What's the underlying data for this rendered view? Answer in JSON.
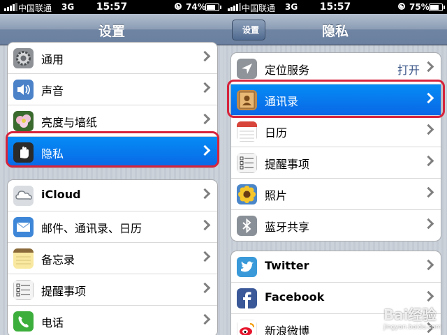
{
  "left": {
    "status": {
      "carrier": "中国联通",
      "network": "3G",
      "time": "15:57",
      "battery": "74%",
      "battery_level": 0.74
    },
    "nav_title": "设置",
    "group1": [
      {
        "label": "通用",
        "icon": "gear-icon"
      },
      {
        "label": "声音",
        "icon": "speaker-icon"
      },
      {
        "label": "亮度与墙纸",
        "icon": "flower-icon"
      },
      {
        "label": "隐私",
        "icon": "hand-icon",
        "selected": true
      }
    ],
    "group2": [
      {
        "label": "iCloud",
        "icon": "cloud-icon"
      },
      {
        "label": "邮件、通讯录、日历",
        "icon": "mail-icon"
      },
      {
        "label": "备忘录",
        "icon": "notes-icon"
      },
      {
        "label": "提醒事项",
        "icon": "reminders-icon"
      },
      {
        "label": "电话",
        "icon": "phone-icon"
      }
    ]
  },
  "right": {
    "status": {
      "carrier": "中国联通",
      "network": "3G",
      "time": "15:57",
      "battery": "75%",
      "battery_level": 0.75
    },
    "back_label": "设置",
    "nav_title": "隐私",
    "group1": [
      {
        "label": "定位服务",
        "icon": "location-arrow-icon",
        "value": "打开"
      },
      {
        "label": "通讯录",
        "icon": "contacts-icon",
        "selected": true
      },
      {
        "label": "日历",
        "icon": "calendar-icon"
      },
      {
        "label": "提醒事项",
        "icon": "reminders-icon"
      },
      {
        "label": "照片",
        "icon": "sunflower-icon"
      },
      {
        "label": "蓝牙共享",
        "icon": "bluetooth-icon"
      }
    ],
    "group2": [
      {
        "label": "Twitter",
        "icon": "twitter-icon"
      },
      {
        "label": "Facebook",
        "icon": "facebook-icon"
      },
      {
        "label": "新浪微博",
        "icon": "weibo-icon"
      }
    ]
  },
  "colors": {
    "highlight": "#d6243c",
    "selection": "#0a67e6"
  },
  "watermark": {
    "text": "Bai经验",
    "sub": "jingyan.baidu.com"
  }
}
